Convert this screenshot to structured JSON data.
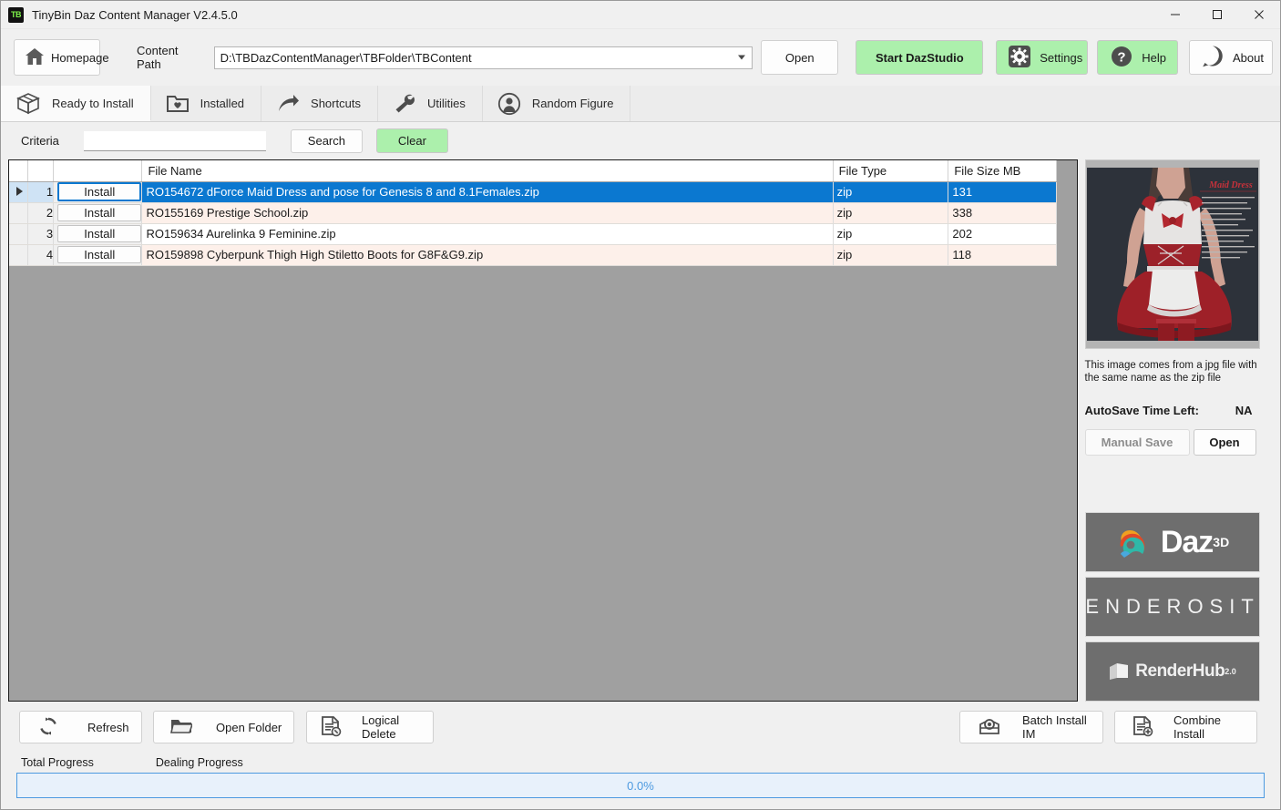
{
  "window": {
    "app_icon_label": "TB",
    "title": "TinyBin Daz Content Manager V2.4.5.0",
    "minimize": "minimize-icon",
    "maximize": "maximize-icon",
    "close": "close-icon"
  },
  "toolbar": {
    "homepage_label": "Homepage",
    "content_path_label": "Content Path",
    "content_path_value": "D:\\TBDazContentManager\\TBFolder\\TBContent",
    "open_label": "Open",
    "start_daz_label": "Start DazStudio",
    "settings_label": "Settings",
    "help_label": "Help",
    "about_label": "About"
  },
  "tabs": [
    {
      "label": "Ready to Install",
      "icon": "box-icon",
      "active": true
    },
    {
      "label": "Installed",
      "icon": "folder-heart-icon",
      "active": false
    },
    {
      "label": "Shortcuts",
      "icon": "arrow-icon",
      "active": false
    },
    {
      "label": "Utilities",
      "icon": "wrench-icon",
      "active": false
    },
    {
      "label": "Random Figure",
      "icon": "person-icon",
      "active": false
    }
  ],
  "search": {
    "criteria_label": "Criteria",
    "criteria_value": "",
    "criteria_placeholder": "",
    "search_label": "Search",
    "clear_label": "Clear"
  },
  "grid": {
    "headers": {
      "marker": "",
      "index": "",
      "install": "",
      "file_name": "File Name",
      "file_type": "File Type",
      "file_size": "File Size MB"
    },
    "install_label": "Install",
    "rows": [
      {
        "index": "1",
        "install": "Install",
        "file_name": "RO154672 dForce Maid Dress and pose for Genesis 8 and 8.1Females.zip",
        "file_type": "zip",
        "file_size": "131",
        "selected": true
      },
      {
        "index": "2",
        "install": "Install",
        "file_name": "RO155169 Prestige School.zip",
        "file_type": "zip",
        "file_size": "338",
        "selected": false
      },
      {
        "index": "3",
        "install": "Install",
        "file_name": "RO159634 Aurelinka 9 Feminine.zip",
        "file_type": "zip",
        "file_size": "202",
        "selected": false
      },
      {
        "index": "4",
        "install": "Install",
        "file_name": "RO159898 Cyberpunk Thigh High Stiletto Boots for G8F&G9.zip",
        "file_type": "zip",
        "file_size": "118",
        "selected": false
      }
    ]
  },
  "preview": {
    "thumbnail_title": "Maid Dress",
    "caption": "This image comes from a jpg file with the same name as the zip file",
    "autosave_label": "AutoSave Time Left:",
    "autosave_value": "NA",
    "manual_save_label": "Manual Save",
    "open_label": "Open"
  },
  "logos": [
    {
      "name": "daz3d-logo",
      "text": "Daz",
      "sup": "3D"
    },
    {
      "name": "renderosity-logo",
      "text": "RENDEROSITY",
      "sup": ""
    },
    {
      "name": "renderhub-logo",
      "text": "RenderHub",
      "sup": "2.0"
    }
  ],
  "bottom": {
    "refresh_label": "Refresh",
    "open_folder_label": "Open Folder",
    "logical_delete_label": "Logical Delete",
    "batch_install_label": "Batch Install IM",
    "combine_install_label": "Combine Install"
  },
  "progress": {
    "total_label": "Total Progress",
    "dealing_label": "Dealing Progress",
    "value_text": "0.0%",
    "percent": 0
  },
  "colors": {
    "accent_green": "#acf0ac",
    "selection_blue": "#0b78d0",
    "alt_row": "#fdf0ea",
    "grid_background": "#a0a0a0",
    "progress_blue": "#4d9ae0"
  }
}
